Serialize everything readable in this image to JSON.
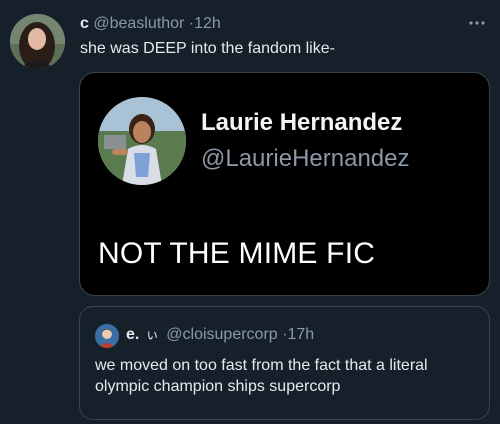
{
  "tweet": {
    "author": {
      "display_name": "c",
      "handle": "@beasluthor",
      "separator": "·",
      "time": "12h"
    },
    "text": "she was DEEP into the fandom like-",
    "more_icon": "more-horizontal-icon",
    "media": {
      "name": "Laurie Hernandez",
      "handle": "@LaurieHernandez",
      "text": "NOT THE MIME FIC"
    },
    "quote": {
      "display_name": "e.",
      "emoji": "ぃ",
      "handle": "@cloisupercorp",
      "separator": "·",
      "time": "17h",
      "text": "we moved on too fast from the fact that a literal olympic champion ships supercorp"
    }
  },
  "colors": {
    "background": "#15202b",
    "text_primary": "#e7e9ea",
    "text_secondary": "#8b98a5",
    "border": "#38444d",
    "media_background": "#000000"
  }
}
